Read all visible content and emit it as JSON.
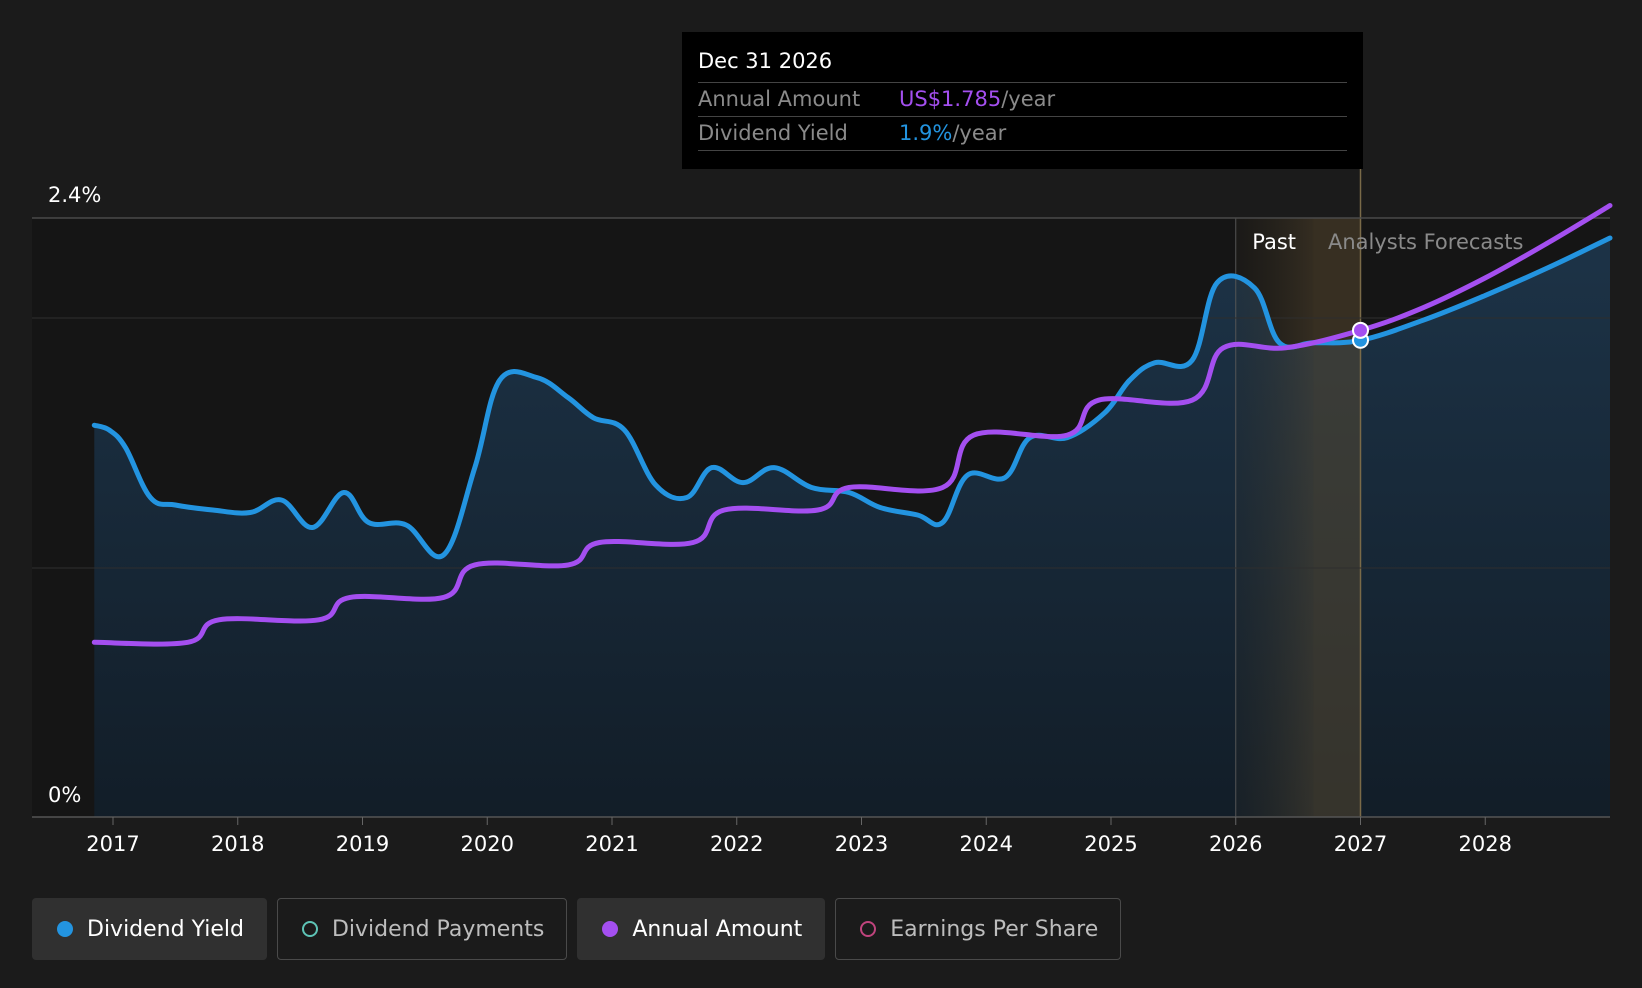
{
  "tooltip": {
    "date": "Dec 31 2026",
    "rows": [
      {
        "label": "Annual Amount",
        "value": "US$1.785",
        "unit": "/year",
        "color": "#a44ff0"
      },
      {
        "label": "Dividend Yield",
        "value": "1.9%",
        "unit": "/year",
        "color": "#2394e0"
      }
    ]
  },
  "legend": [
    {
      "label": "Dividend Yield",
      "active": true,
      "filled": true,
      "color": "#2394e0"
    },
    {
      "label": "Dividend Payments",
      "active": false,
      "filled": false,
      "color": "#5ec4b6"
    },
    {
      "label": "Annual Amount",
      "active": true,
      "filled": true,
      "color": "#a44ff0"
    },
    {
      "label": "Earnings Per Share",
      "active": false,
      "filled": false,
      "color": "#c0447d"
    }
  ],
  "chart_data": {
    "type": "line",
    "y_tick_labels": [
      "2.4%",
      "0%"
    ],
    "ylim": [
      0,
      2.4
    ],
    "xlim": [
      2016.0,
      2029.0
    ],
    "x_ticks": [
      2017,
      2018,
      2019,
      2020,
      2021,
      2022,
      2023,
      2024,
      2025,
      2026,
      2027,
      2028
    ],
    "past_label": "Past",
    "forecast_label": "Analysts Forecasts",
    "past_start": 2026.0,
    "forecast_start": 2026.62,
    "cursor_x": 2027.0,
    "series": [
      {
        "name": "Dividend Yield",
        "color": "#2394e0",
        "points": [
          [
            2016.85,
            1.57
          ],
          [
            2016.97,
            1.55
          ],
          [
            2017.1,
            1.48
          ],
          [
            2017.3,
            1.28
          ],
          [
            2017.5,
            1.25
          ],
          [
            2017.8,
            1.23
          ],
          [
            2018.1,
            1.22
          ],
          [
            2018.35,
            1.27
          ],
          [
            2018.6,
            1.16
          ],
          [
            2018.85,
            1.3
          ],
          [
            2019.05,
            1.18
          ],
          [
            2019.35,
            1.17
          ],
          [
            2019.65,
            1.05
          ],
          [
            2019.9,
            1.4
          ],
          [
            2020.1,
            1.75
          ],
          [
            2020.4,
            1.76
          ],
          [
            2020.65,
            1.68
          ],
          [
            2020.85,
            1.6
          ],
          [
            2021.1,
            1.55
          ],
          [
            2021.35,
            1.33
          ],
          [
            2021.6,
            1.28
          ],
          [
            2021.8,
            1.4
          ],
          [
            2022.05,
            1.34
          ],
          [
            2022.3,
            1.4
          ],
          [
            2022.6,
            1.32
          ],
          [
            2022.9,
            1.3
          ],
          [
            2023.15,
            1.24
          ],
          [
            2023.45,
            1.21
          ],
          [
            2023.65,
            1.18
          ],
          [
            2023.85,
            1.37
          ],
          [
            2024.15,
            1.36
          ],
          [
            2024.35,
            1.52
          ],
          [
            2024.65,
            1.52
          ],
          [
            2024.95,
            1.62
          ],
          [
            2025.15,
            1.75
          ],
          [
            2025.35,
            1.82
          ],
          [
            2025.65,
            1.83
          ],
          [
            2025.85,
            2.14
          ],
          [
            2026.15,
            2.12
          ],
          [
            2026.35,
            1.9
          ],
          [
            2026.62,
            1.9
          ],
          [
            2027.0,
            1.91
          ],
          [
            2027.5,
            1.99
          ],
          [
            2028.0,
            2.09
          ],
          [
            2028.5,
            2.2
          ],
          [
            2029.0,
            2.32
          ]
        ]
      },
      {
        "name": "Annual Amount",
        "color": "#a44ff0",
        "points": [
          [
            2016.85,
            0.7
          ],
          [
            2017.6,
            0.7
          ],
          [
            2017.85,
            0.79
          ],
          [
            2018.65,
            0.79
          ],
          [
            2018.9,
            0.88
          ],
          [
            2019.65,
            0.88
          ],
          [
            2019.9,
            1.01
          ],
          [
            2020.65,
            1.01
          ],
          [
            2020.9,
            1.1
          ],
          [
            2021.65,
            1.1
          ],
          [
            2021.9,
            1.23
          ],
          [
            2022.65,
            1.23
          ],
          [
            2022.9,
            1.32
          ],
          [
            2023.65,
            1.32
          ],
          [
            2023.9,
            1.53
          ],
          [
            2024.65,
            1.53
          ],
          [
            2024.9,
            1.67
          ],
          [
            2025.65,
            1.67
          ],
          [
            2025.9,
            1.88
          ],
          [
            2026.4,
            1.88
          ],
          [
            2027.0,
            1.95
          ],
          [
            2027.5,
            2.04
          ],
          [
            2028.0,
            2.16
          ],
          [
            2028.5,
            2.3
          ],
          [
            2029.0,
            2.45
          ]
        ]
      }
    ]
  }
}
